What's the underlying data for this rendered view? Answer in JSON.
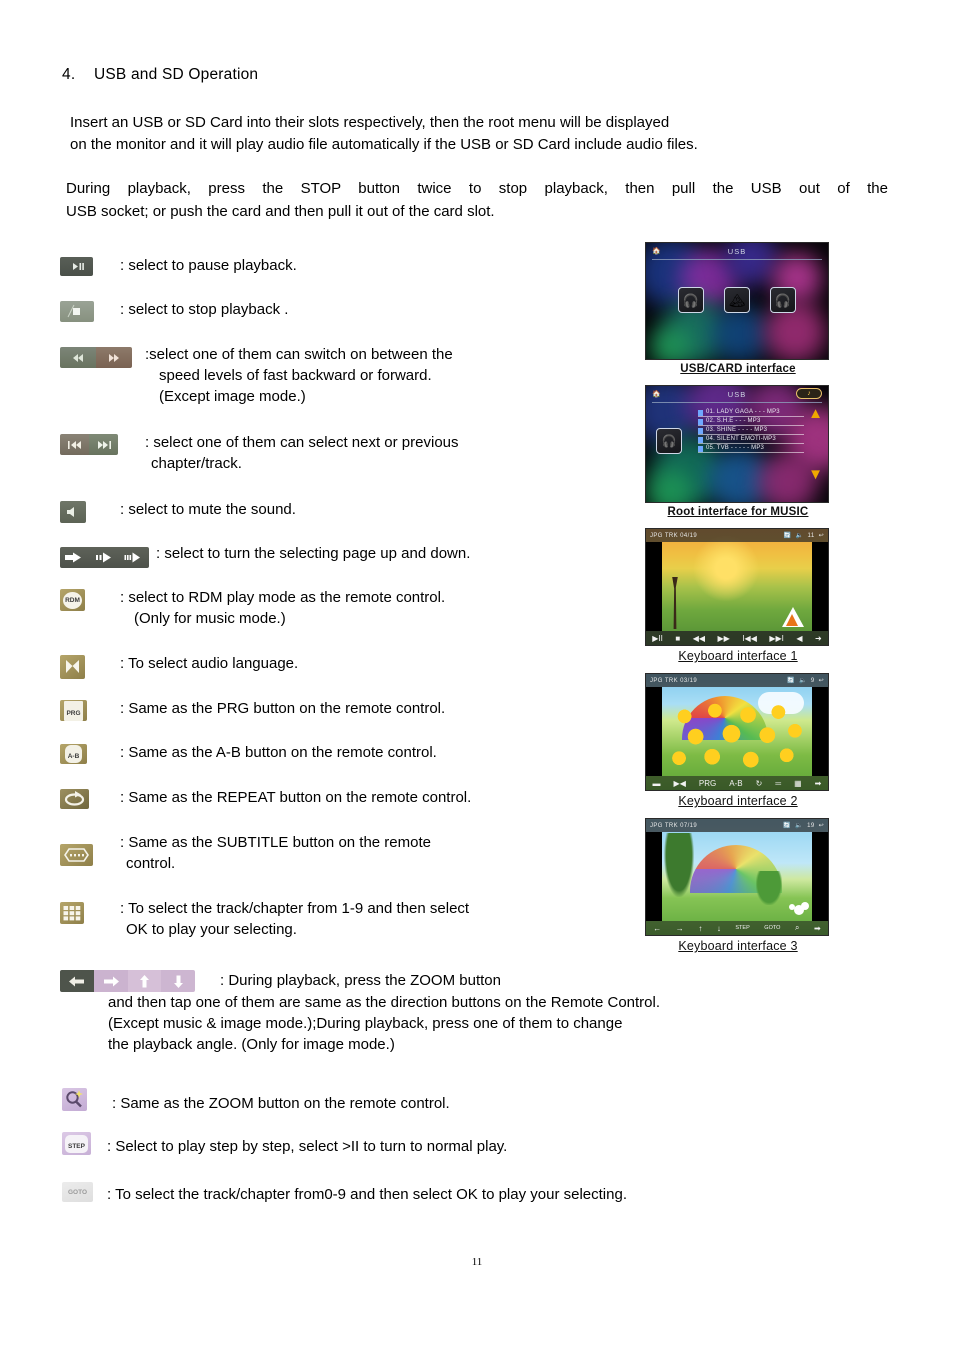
{
  "section": {
    "number": "4.",
    "title": "USB and SD Operation"
  },
  "intro": {
    "p1_line1": "Insert an USB or SD Card into their slots respectively, then the root menu will be displayed",
    "p1_line2": "on the monitor and it will play audio file automatically if the USB or SD Card include audio files.",
    "p2_line1": "During playback, press the STOP button twice to stop playback, then pull the USB out of the",
    "p2_line2": "USB socket; or push the card and then pull it out of the card slot."
  },
  "items": [
    {
      "icon": "play-pause-icon",
      "text": ": select to pause playback."
    },
    {
      "icon": "stop-icon",
      "text": ": select to stop playback ."
    },
    {
      "icon": "fast-rewind-forward-icon",
      "text": ":select one of them can switch on between the",
      "line2": "speed levels of fast backward or forward.",
      "line3": "(Except image mode.)"
    },
    {
      "icon": "previous-next-track-icon",
      "text": ": select one of them can select next or previous",
      "line2": "chapter/track."
    },
    {
      "icon": "mute-icon",
      "text": ": select to mute the sound."
    },
    {
      "icon": "page-updown-icon",
      "text": ": select to turn the selecting page up and down."
    },
    {
      "icon": "rdm-icon",
      "label": "RDM",
      "text": ": select to RDM play mode as the remote control.",
      "line2": "(Only for music mode.)"
    },
    {
      "icon": "audio-language-icon",
      "text": ": To select audio language."
    },
    {
      "icon": "prg-icon",
      "label": "PRG",
      "text": ": Same as the PRG button on the remote control."
    },
    {
      "icon": "ab-repeat-icon",
      "label": "A-B",
      "text": ": Same as the A-B button on the remote control."
    },
    {
      "icon": "repeat-icon",
      "text": ": Same as the REPEAT button on the remote control."
    },
    {
      "icon": "subtitle-icon",
      "text": ": Same as the SUBTITLE button on the remote",
      "line2": "control."
    },
    {
      "icon": "keypad-grid-icon",
      "text": ": To select the track/chapter from 1-9 and then select",
      "line2": "OK to play your selecting."
    },
    {
      "icon": "direction-buttons-icon",
      "text": ": During playback, press the ZOOM button",
      "line2": "and then tap one of them are same as the direction buttons on the Remote Control.",
      "line3": "(Except music & image mode.);During playback, press one of them to change",
      "line4": "the playback angle. (Only for image mode.)"
    },
    {
      "icon": "zoom-icon",
      "text": ": Same as the ZOOM button on the remote control."
    },
    {
      "icon": "step-icon",
      "label": "STEP",
      "text": ": Select to play step by step, select >II to turn to normal play."
    },
    {
      "icon": "goto-icon",
      "label": "GOTO",
      "text": ": To select the track/chapter from0-9 and then select OK to play your selecting."
    }
  ],
  "screenshots": [
    {
      "caption": "USB/CARD interface",
      "name": "usb-card-interface-screenshot",
      "title_bar": "USB",
      "home_icon": "home-icon",
      "tiles": [
        "music-tile",
        "photo-tile",
        "music-tile"
      ]
    },
    {
      "caption": "Root interface for MUSIC",
      "name": "root-interface-music-screenshot",
      "title_bar": "USB",
      "home_icon": "home-icon",
      "tracks": [
        "01. LADY GAGA - -  - MP3",
        "02. S.H.E -  - - MP3",
        "03. SHINE - - - - MP3",
        "04. SILENT EMOTI-MP3",
        "05. TVB - - - - - MP3"
      ],
      "scroll_up_icon": "chevron-up-icon",
      "scroll_down_icon": "chevron-down-icon"
    },
    {
      "caption": "Keyboard interface 1",
      "name": "keyboard-interface-1-screenshot",
      "osd_left": "JPG TRK 04/19",
      "osd_volume": "11",
      "buttons": [
        "▶II",
        "■",
        "◀◀",
        "▶▶",
        "I◀◀",
        "▶▶I",
        "◀",
        "➜"
      ]
    },
    {
      "caption": "Keyboard interface 2",
      "name": "keyboard-interface-2-screenshot",
      "osd_left": "JPG TRK 03/19",
      "osd_volume": "9",
      "buttons": [
        "▬",
        "▶◀",
        "PRG",
        "A-B",
        "↻",
        "═",
        "▦",
        "➡"
      ]
    },
    {
      "caption": "Keyboard interface 3",
      "name": "keyboard-interface-3-screenshot",
      "osd_left": "JPG TRK 07/19",
      "osd_volume": "19",
      "buttons": [
        "←",
        "→",
        "↑",
        "↓",
        "STEP",
        "GOTO",
        "⌕",
        "➡"
      ]
    }
  ],
  "page_number": "11"
}
